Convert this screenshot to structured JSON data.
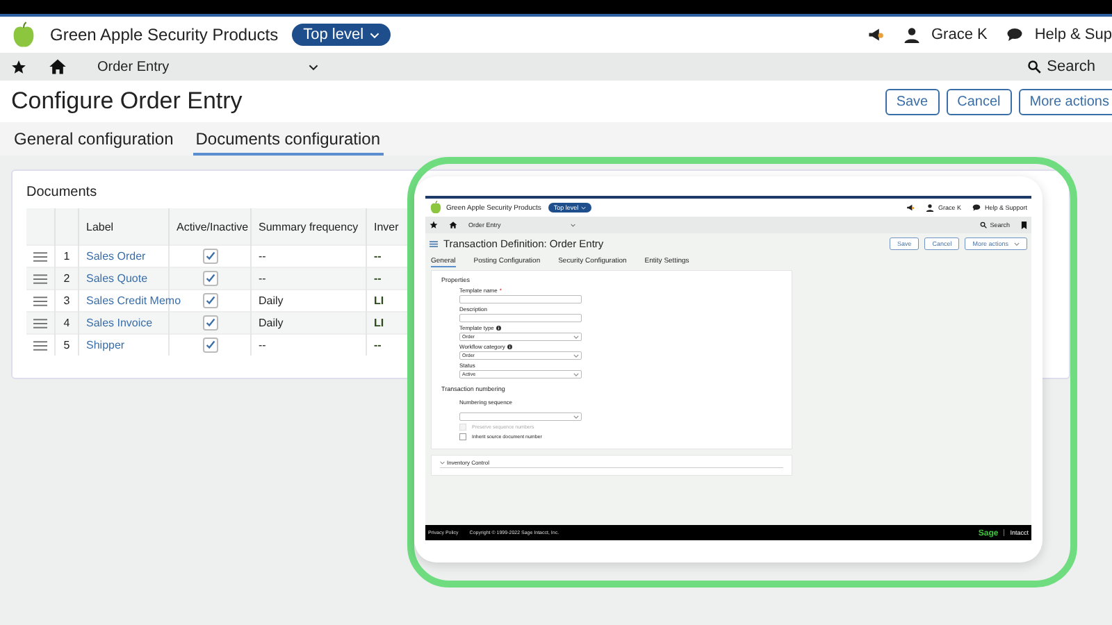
{
  "header": {
    "brand": "Green Apple Security Products",
    "level": "Top level",
    "user": "Grace K",
    "help": "Help & Sup"
  },
  "nav": {
    "page": "Order Entry",
    "search": "Search"
  },
  "page_title": "Configure Order Entry",
  "buttons": [
    "Save",
    "Cancel",
    "More actions"
  ],
  "tabs": [
    {
      "label": "General configuration",
      "selected": false
    },
    {
      "label": "Documents configuration",
      "selected": true
    }
  ],
  "documents": {
    "title": "Documents",
    "columns": [
      "Label",
      "Active/Inactive",
      "Summary frequency",
      "Inver"
    ],
    "rows": [
      {
        "number": "1",
        "label": "Sales Order",
        "active": true,
        "summary_frequency": "--",
        "column_5": "--"
      },
      {
        "number": "2",
        "label": "Sales Quote",
        "active": true,
        "summary_frequency": "--",
        "column_5": "--"
      },
      {
        "number": "3",
        "label": "Sales Credit Memo",
        "active": true,
        "summary_frequency": "Daily",
        "column_5": "LI"
      },
      {
        "number": "4",
        "label": "Sales Invoice",
        "active": true,
        "summary_frequency": "Daily",
        "column_5": "LI"
      },
      {
        "number": "5",
        "label": "Shipper",
        "active": true,
        "summary_frequency": "--",
        "column_5": "--"
      }
    ]
  },
  "overlay": {
    "brand": "Green Apple Security Products",
    "level": "Top level",
    "user": "Grace K",
    "help": "Help & Support",
    "nav_page": "Order Entry",
    "search": "Search",
    "title": "Transaction Definition: Order Entry",
    "buttons": [
      "Save",
      "Cancel",
      "More actions"
    ],
    "tabs": [
      {
        "label": "General",
        "selected": true
      },
      {
        "label": "Posting Configuration",
        "selected": false
      },
      {
        "label": "Security Configuration",
        "selected": false
      },
      {
        "label": "Entity Settings",
        "selected": false
      }
    ],
    "properties": {
      "title": "Properties",
      "fields": [
        {
          "kind": "text",
          "label": "Template name",
          "marker": "*",
          "info": false
        },
        {
          "kind": "text",
          "label": "Description",
          "info": false
        },
        {
          "kind": "select",
          "label": "Template type",
          "info": true,
          "value": "Order"
        },
        {
          "kind": "select",
          "label": "Workflow category",
          "info": true,
          "value": "Order"
        },
        {
          "kind": "select",
          "label": "Status",
          "info": false,
          "value": "Active"
        }
      ]
    },
    "numbering": {
      "title": "Transaction numbering",
      "field_label": "Numbering sequence",
      "checkboxes": [
        {
          "label": "Preserve sequence numbers",
          "checked": false,
          "disabled": true
        },
        {
          "label": "Inherit source document number",
          "checked": false,
          "disabled": false
        }
      ]
    },
    "section": {
      "title": "Inventory Control",
      "expanded": false
    },
    "footer": {
      "links": [
        "Privacy Policy"
      ],
      "copyright": "Copyright © 1999-2022 Sage Intacct, Inc.",
      "logo": "Sage",
      "logo_product": "Intacct"
    }
  }
}
